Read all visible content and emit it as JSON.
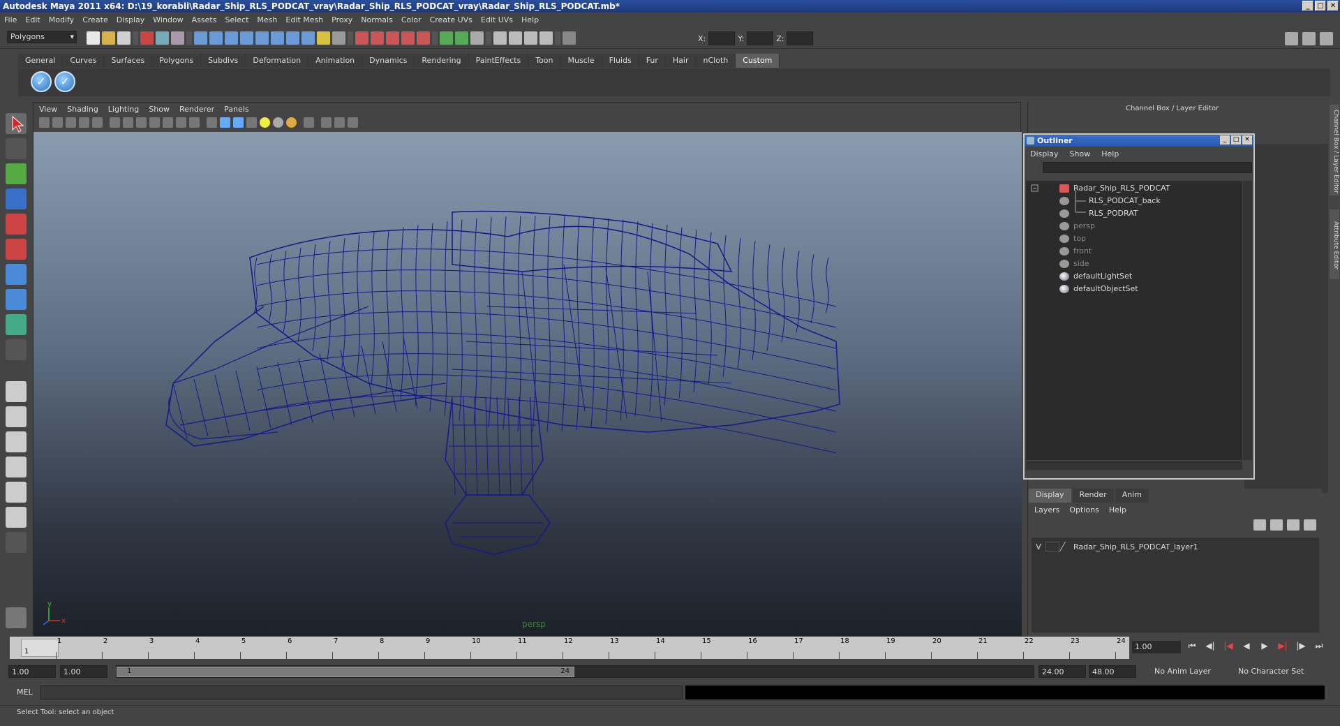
{
  "window": {
    "title": "Autodesk Maya 2011 x64: D:\\19_korabli\\Radar_Ship_RLS_PODCAT_vray\\Radar_Ship_RLS_PODCAT_vray\\Radar_Ship_RLS_PODCAT.mb*"
  },
  "menubar": [
    "File",
    "Edit",
    "Modify",
    "Create",
    "Display",
    "Window",
    "Assets",
    "Select",
    "Mesh",
    "Edit Mesh",
    "Proxy",
    "Normals",
    "Color",
    "Create UVs",
    "Edit UVs",
    "Help"
  ],
  "statusline": {
    "mode": "Polygons",
    "x_label": "X:",
    "y_label": "Y:",
    "z_label": "Z:"
  },
  "shelf": {
    "tabs": [
      "General",
      "Curves",
      "Surfaces",
      "Polygons",
      "Subdivs",
      "Deformation",
      "Animation",
      "Dynamics",
      "Rendering",
      "PaintEffects",
      "Toon",
      "Muscle",
      "Fluids",
      "Fur",
      "Hair",
      "nCloth",
      "Custom"
    ],
    "active_tab": "Custom"
  },
  "viewport": {
    "menu": [
      "View",
      "Shading",
      "Lighting",
      "Show",
      "Renderer",
      "Panels"
    ],
    "camera_label": "persp",
    "axis_y": "y",
    "axis_x": "x",
    "wire_color": "#14188c"
  },
  "channel_box": {
    "title": "Channel Box / Layer Editor"
  },
  "side_tabs": {
    "channel": "Channel Box / Layer Editor",
    "attribute": "Attribute Editor"
  },
  "outliner": {
    "title": "Outliner",
    "menu": [
      "Display",
      "Show",
      "Help"
    ],
    "items": [
      {
        "label": "Radar_Ship_RLS_PODCAT"
      },
      {
        "label": "RLS_PODCAT_back"
      },
      {
        "label": "RLS_PODRAT"
      },
      {
        "label": "persp"
      },
      {
        "label": "top"
      },
      {
        "label": "front"
      },
      {
        "label": "side"
      },
      {
        "label": "defaultLightSet"
      },
      {
        "label": "defaultObjectSet"
      }
    ]
  },
  "layer_editor": {
    "tabs": [
      "Display",
      "Render",
      "Anim"
    ],
    "menu": [
      "Layers",
      "Options",
      "Help"
    ],
    "layer": {
      "visible": "V",
      "name": "Radar_Ship_RLS_PODCAT_layer1"
    }
  },
  "timeline": {
    "ticks": [
      "1",
      "2",
      "3",
      "4",
      "5",
      "6",
      "7",
      "8",
      "9",
      "10",
      "11",
      "12",
      "13",
      "14",
      "15",
      "16",
      "17",
      "18",
      "19",
      "20",
      "21",
      "22",
      "23",
      "24"
    ],
    "current_frame": "1",
    "current_time": "1.00"
  },
  "range": {
    "start": "1.00",
    "playback_start": "1.00",
    "slider_start": "1",
    "slider_end": "24",
    "playback_end": "24.00",
    "end": "48.00",
    "anim_layer": "No Anim Layer",
    "character_set": "No Character Set"
  },
  "command": {
    "label": "MEL"
  },
  "help_line": "Select Tool: select an object"
}
